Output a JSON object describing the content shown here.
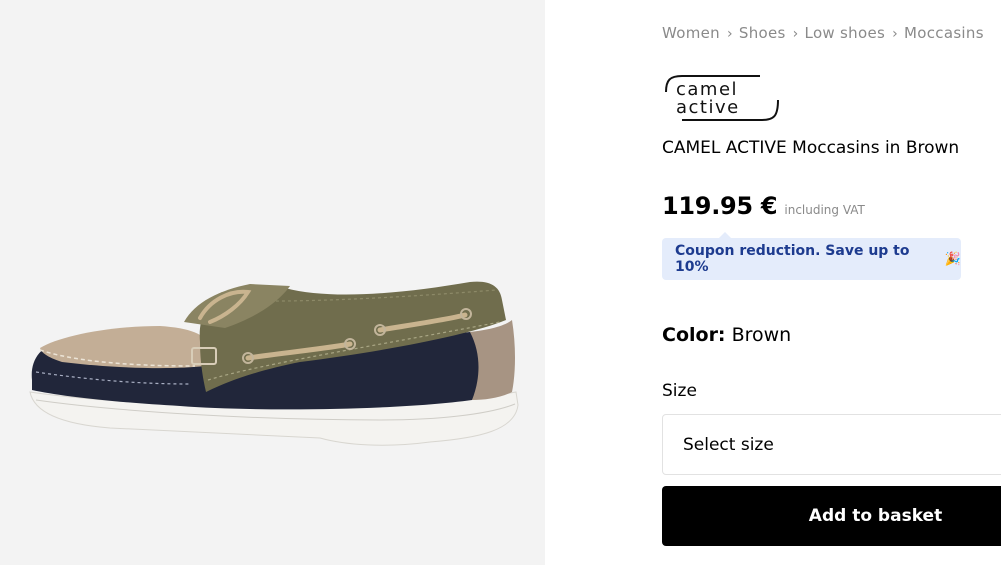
{
  "breadcrumb": [
    "Women",
    "Shoes",
    "Low shoes",
    "Moccasins"
  ],
  "brand": {
    "logo_line1": "camel",
    "logo_line2": "active"
  },
  "product": {
    "title": "CAMEL ACTIVE Moccasins in Brown",
    "price": "119.95 €",
    "vat_note": "including VAT"
  },
  "coupon": {
    "text": "Coupon reduction. Save up to 10%",
    "emoji": "🎉"
  },
  "color": {
    "label": "Color:",
    "value": "Brown"
  },
  "size": {
    "label": "Size",
    "placeholder": "Select size"
  },
  "actions": {
    "add_to_basket": "Add to basket"
  },
  "colors": {
    "gallery_bg": "#f3f3f3",
    "coupon_bg": "#e4ecfb",
    "coupon_text": "#1d3b8f",
    "button_bg": "#000000",
    "shoe_navy": "#20253a",
    "shoe_olive": "#6f6c4c",
    "shoe_beige": "#bba68f",
    "sole": "#f2f1ee"
  }
}
